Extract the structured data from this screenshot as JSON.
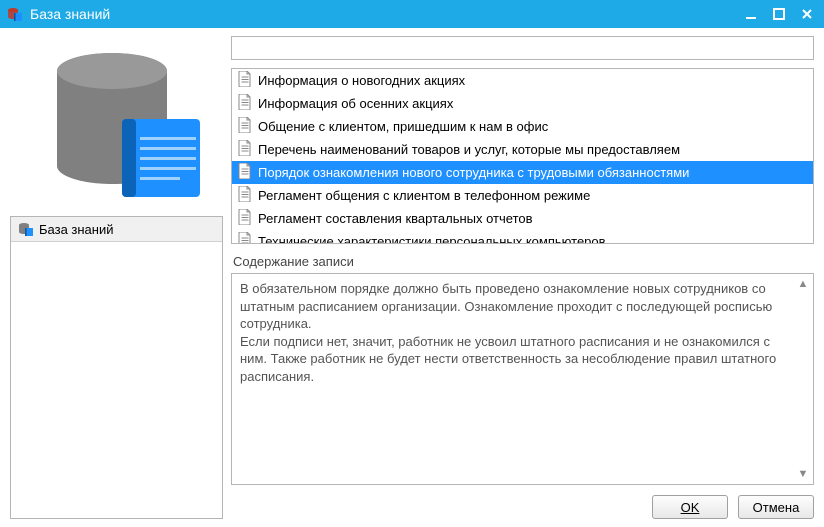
{
  "window": {
    "title": "База знаний"
  },
  "sidebar": {
    "items": [
      {
        "label": "База знаний"
      }
    ]
  },
  "search": {
    "value": ""
  },
  "list": {
    "items": [
      {
        "label": "Информация о новогодних акциях",
        "selected": false
      },
      {
        "label": "Информация об осенних акциях",
        "selected": false
      },
      {
        "label": "Общение с клиентом, пришедшим к нам в офис",
        "selected": false
      },
      {
        "label": "Перечень наименований товаров и услуг, которые мы предоставляем",
        "selected": false
      },
      {
        "label": "Порядок ознакомления нового сотрудника с трудовыми обязанностями",
        "selected": true
      },
      {
        "label": "Регламент общения с клиентом в телефонном режиме",
        "selected": false
      },
      {
        "label": "Регламент составления квартальных отчетов",
        "selected": false
      },
      {
        "label": "Технические характеристики персональных компьютеров",
        "selected": false
      }
    ]
  },
  "content_section": {
    "label": "Содержание записи",
    "body": "В обязательном порядке должно быть проведено ознакомление новых сотрудников со штатным расписанием организации. Ознакомление проходит с последующей росписью сотрудника.\nЕсли подписи нет, значит, работник не усвоил штатного расписания и не ознакомился с ним. Также работник не будет нести ответственность за несоблюдение правил штатного расписания."
  },
  "buttons": {
    "ok": "OK",
    "cancel": "Отмена"
  }
}
